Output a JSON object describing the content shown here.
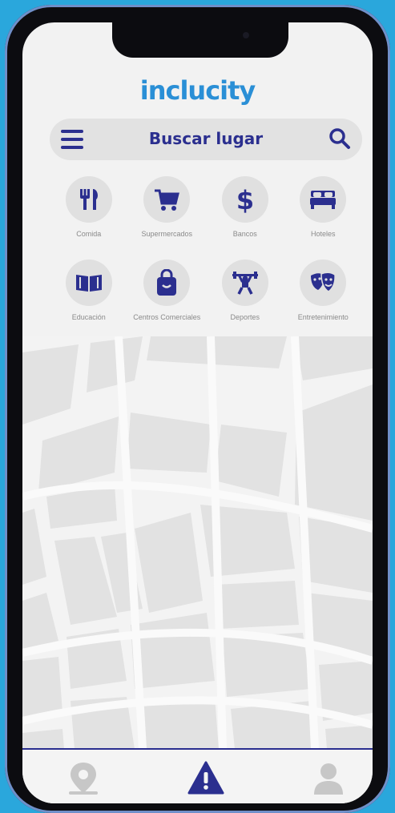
{
  "app": {
    "logo": "inclucity"
  },
  "search": {
    "placeholder": "Buscar lugar"
  },
  "categories": [
    {
      "label": "Comida",
      "icon": "fork-knife-icon"
    },
    {
      "label": "Supermercados",
      "icon": "shopping-cart-icon"
    },
    {
      "label": "Bancos",
      "icon": "dollar-icon"
    },
    {
      "label": "Hoteles",
      "icon": "bed-icon"
    },
    {
      "label": "Educación",
      "icon": "book-icon"
    },
    {
      "label": "Centros Comerciales",
      "icon": "shopping-bag-icon"
    },
    {
      "label": "Deportes",
      "icon": "weightlifting-icon"
    },
    {
      "label": "Entretenimiento",
      "icon": "theater-masks-icon"
    }
  ],
  "bottom_nav": [
    {
      "icon": "map-pin-icon",
      "active": false
    },
    {
      "icon": "alert-icon",
      "active": true
    },
    {
      "icon": "user-icon",
      "active": false
    }
  ],
  "colors": {
    "accent": "#2b2f8f",
    "logo": "#2a8fd6",
    "background": "#2aa7dc"
  }
}
